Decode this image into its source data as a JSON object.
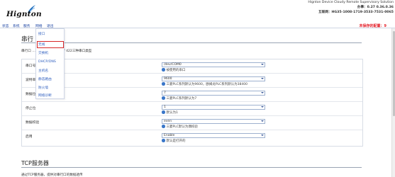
{
  "header": {
    "logo": "Hignton",
    "line1": "Hignton Device Cloudy Remote Supervisory Solution",
    "line2": "办事：0.27 0.36.0.36",
    "line3": "互联网：HG35-1008-1719-3533-7531-0065"
  },
  "menubar": {
    "items": [
      "状态",
      "系统",
      "服务",
      "网络",
      "退出"
    ],
    "warning": "未保存的配置：9"
  },
  "dropdown": {
    "items": [
      "接口",
      "无线",
      "交换机",
      "DHCP/DNS",
      "主机名",
      "静态路由",
      "防火墙",
      "网络诊断"
    ]
  },
  "section": {
    "title": "串行",
    "desc": "串行口 … 支持RS232 / 485 / 422三种串口类型"
  },
  "form": {
    "rows": [
      {
        "label": "串口号",
        "value": "/dev/COM0",
        "hint": "被使用的串口"
      },
      {
        "label": "波特率",
        "value": "9600",
        "hint": "三菱PLC系列默认为9600，欧姆龙PLC系列默认为38400"
      },
      {
        "label": "数据位",
        "value": "7",
        "hint": "三菱PLC系列默认为7"
      },
      {
        "label": "停止位",
        "value": "1",
        "hint": "默认为1"
      },
      {
        "label": "数据校验",
        "value": "even",
        "hint": "三菱PLC默认为偶校验"
      },
      {
        "label": "启用",
        "value": "Enable",
        "hint": "默认是打开的"
      }
    ]
  },
  "tcp": {
    "title": "TCP服务器",
    "desc": "通过TCP服务器，提供对串行口的数据透传"
  }
}
